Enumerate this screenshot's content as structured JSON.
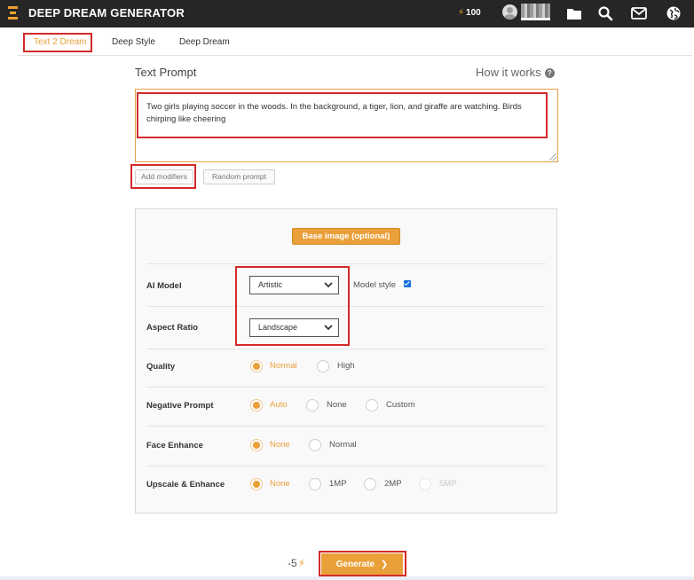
{
  "app": {
    "brand": "DEEP DREAM GENERATOR",
    "energy_count": "100"
  },
  "tabs": [
    {
      "label": "Text 2 Dream",
      "active": true
    },
    {
      "label": "Deep Style",
      "active": false
    },
    {
      "label": "Deep Dream",
      "active": false
    }
  ],
  "prompt": {
    "title": "Text Prompt",
    "help_link": "How it works",
    "value": "Two girls playing soccer in the woods. In the background, a tiger, lion, and giraffe are watching. Birds chirping like cheering",
    "add_modifiers": "Add modifiers",
    "random_prompt": "Random prompt"
  },
  "settings": {
    "base_image_button": "Base image (optional)",
    "ai_model": {
      "label": "AI Model",
      "selected": "Artistic",
      "model_style_label": "Model style",
      "model_style_checked": true
    },
    "aspect_ratio": {
      "label": "Aspect Ratio",
      "selected": "Landscape"
    },
    "quality": {
      "label": "Quality",
      "options": [
        "Normal",
        "High"
      ],
      "selected": "Normal"
    },
    "negative_prompt": {
      "label": "Negative Prompt",
      "options": [
        "Auto",
        "None",
        "Custom"
      ],
      "selected": "Auto"
    },
    "face_enhance": {
      "label": "Face Enhance",
      "options": [
        "None",
        "Normal"
      ],
      "selected": "None"
    },
    "upscale": {
      "label": "Upscale & Enhance",
      "options": [
        "None",
        "1MP",
        "2MP",
        "5MP"
      ],
      "selected": "None",
      "disabled": [
        "5MP"
      ]
    }
  },
  "generate": {
    "cost": "-5",
    "label": "Generate"
  },
  "colors": {
    "accent": "#e9a039",
    "topbar": "#262626",
    "highlight": "#d42a2a",
    "checkbox": "#1a6fe0"
  },
  "icons": {
    "logo": "stacked-bars-logo-icon",
    "energy": "lightning-bolt-icon",
    "folder": "folder-icon",
    "search": "search-icon",
    "mail": "envelope-icon",
    "globe": "globe-icon",
    "help": "question-circle-icon",
    "select": "chevron-down-icon",
    "generate": "chevron-right-icon"
  }
}
